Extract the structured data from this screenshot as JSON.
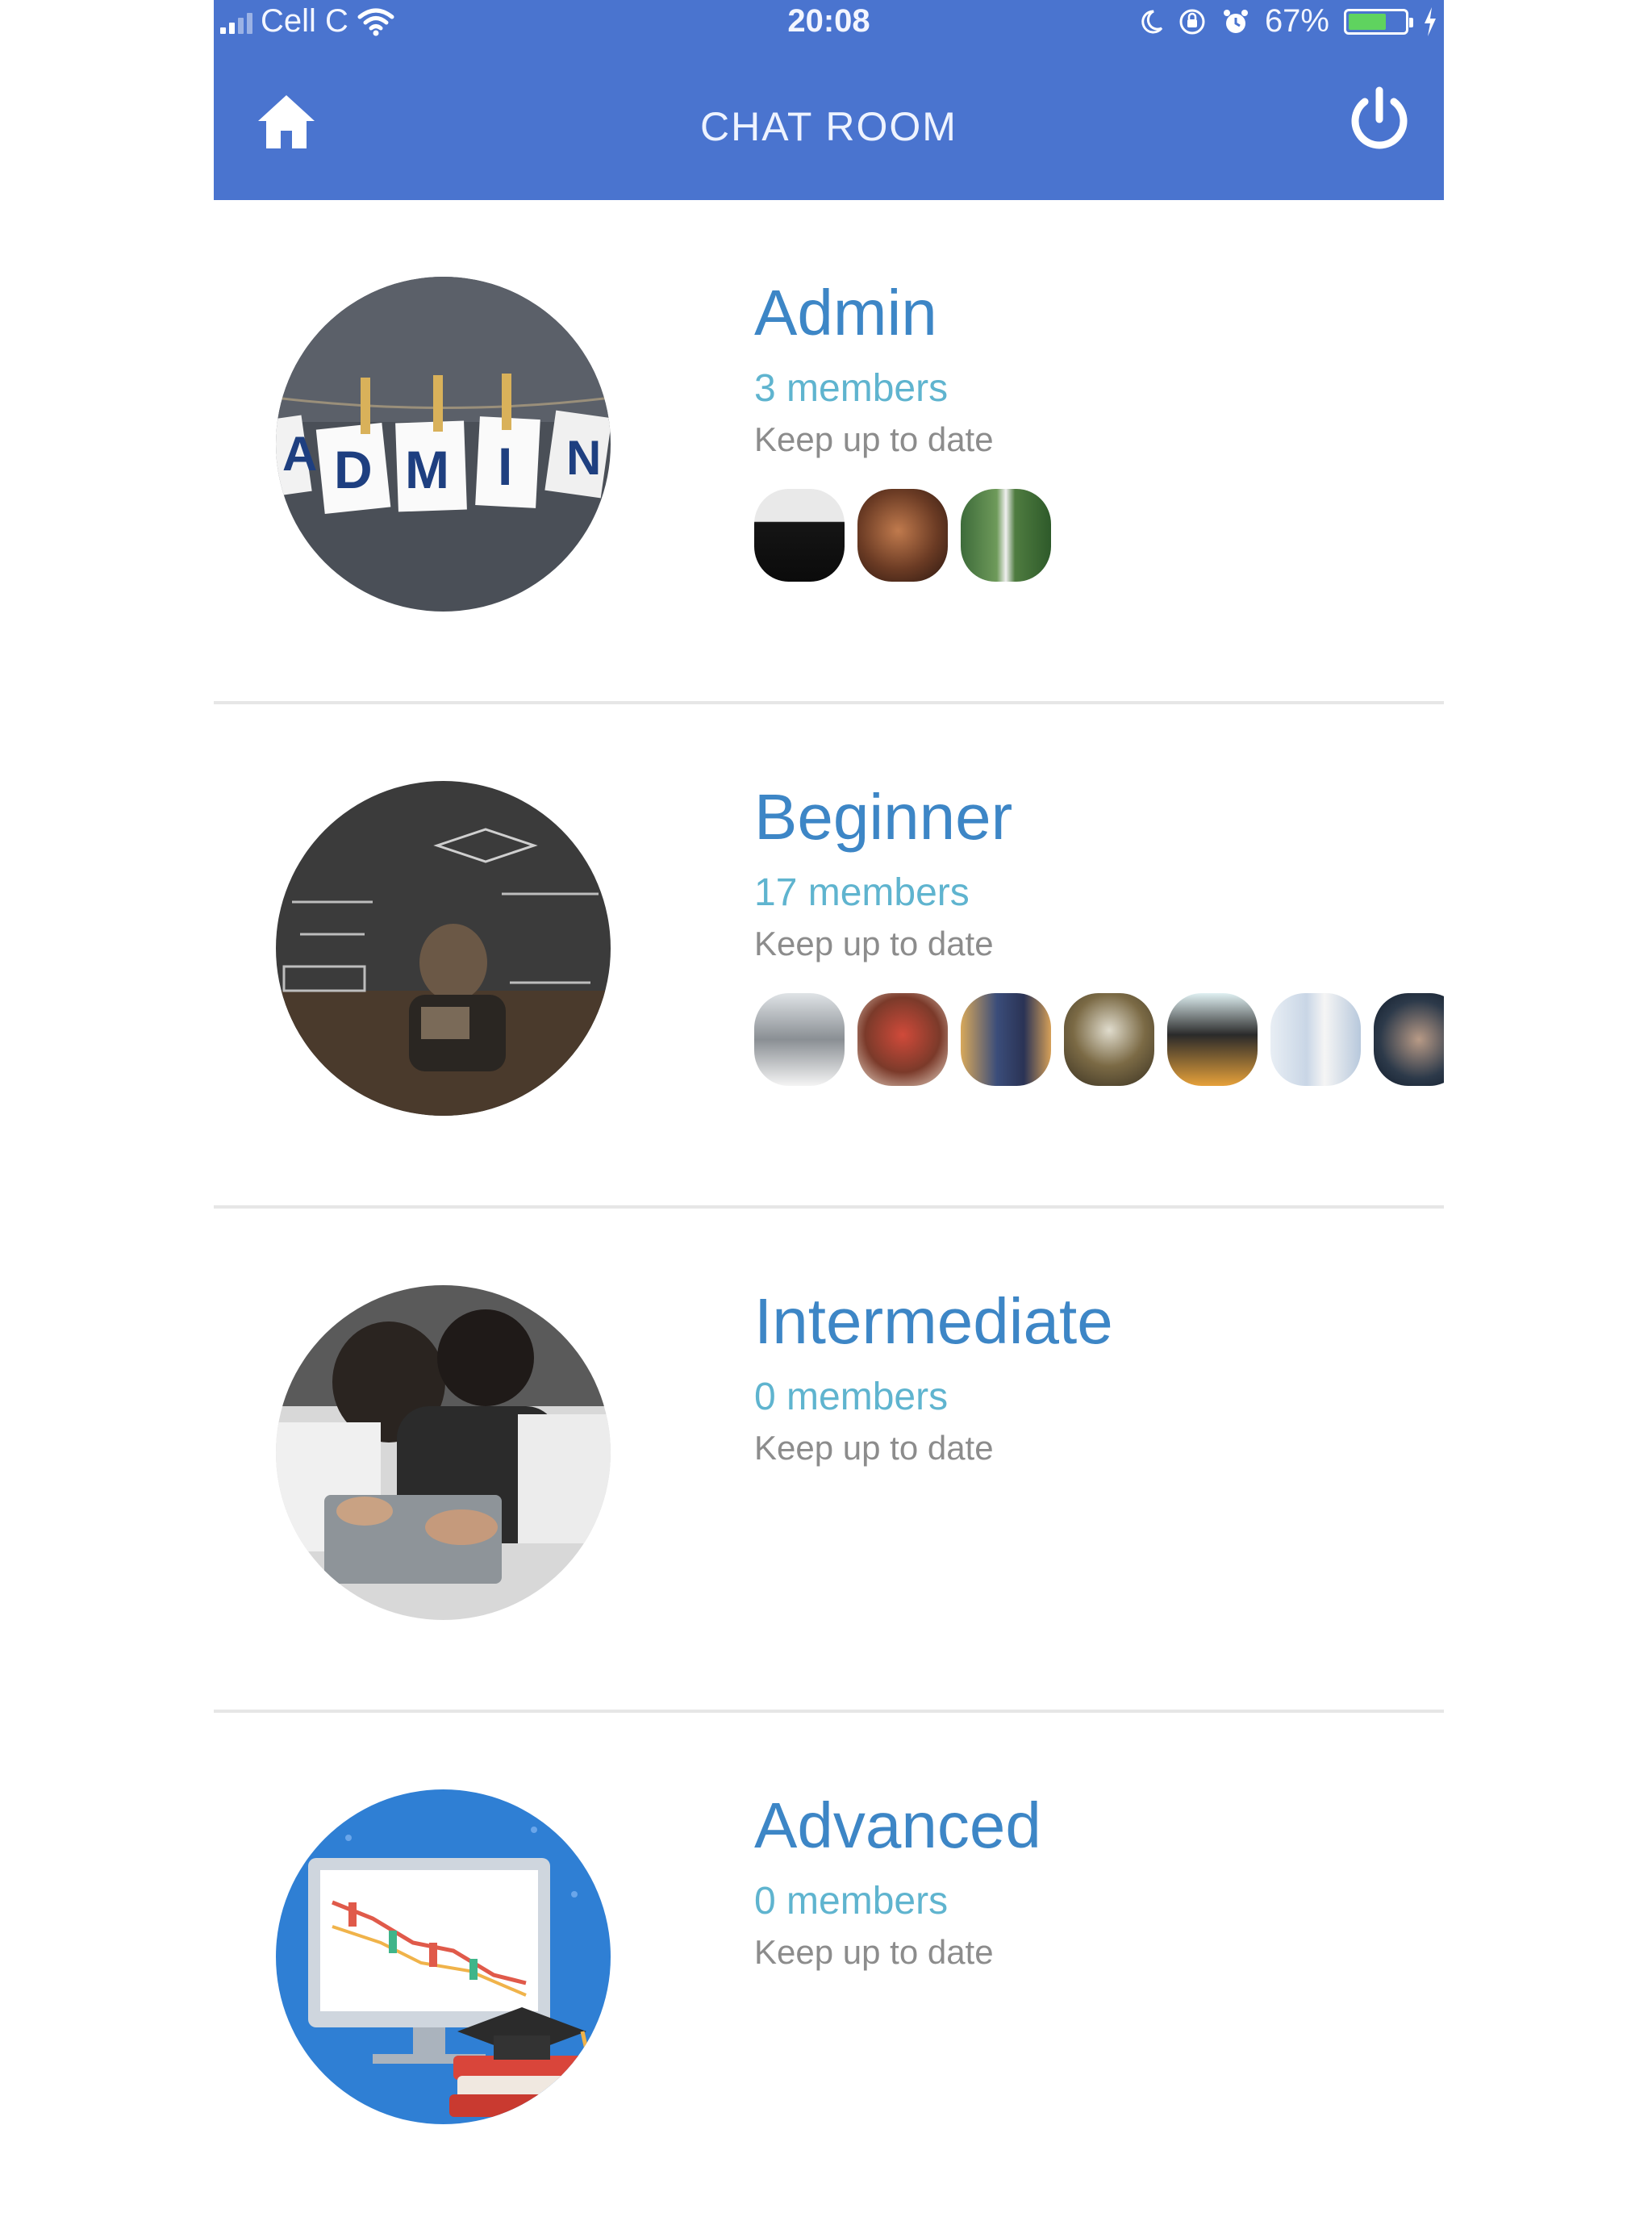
{
  "status_bar": {
    "carrier": "Cell C",
    "time": "20:08",
    "battery": "67%",
    "battery_level": 0.67,
    "battery_color": "#5fd35f"
  },
  "header": {
    "title": "CHAT ROOM",
    "background_color": "#4a74cf"
  },
  "rooms": [
    {
      "name": "Admin",
      "members": "3 members",
      "subtitle": "Keep up to date",
      "avatar_icon": "admin-letters-photo",
      "member_count_shown": 3
    },
    {
      "name": "Beginner",
      "members": "17 members",
      "subtitle": "Keep up to date",
      "avatar_icon": "cat-with-graduation-cap-photo",
      "member_count_shown": 7
    },
    {
      "name": "Intermediate",
      "members": "0 members",
      "subtitle": "Keep up to date",
      "avatar_icon": "people-at-laptops-photo",
      "member_count_shown": 0
    },
    {
      "name": "Advanced",
      "members": "0 members",
      "subtitle": "Keep up to date",
      "avatar_icon": "trading-chart-graduation-illustration",
      "member_count_shown": 0
    }
  ],
  "colors": {
    "room_name": "#3d86c6",
    "members_text": "#5fb4cf",
    "subtitle_text": "#8c8c8c"
  }
}
